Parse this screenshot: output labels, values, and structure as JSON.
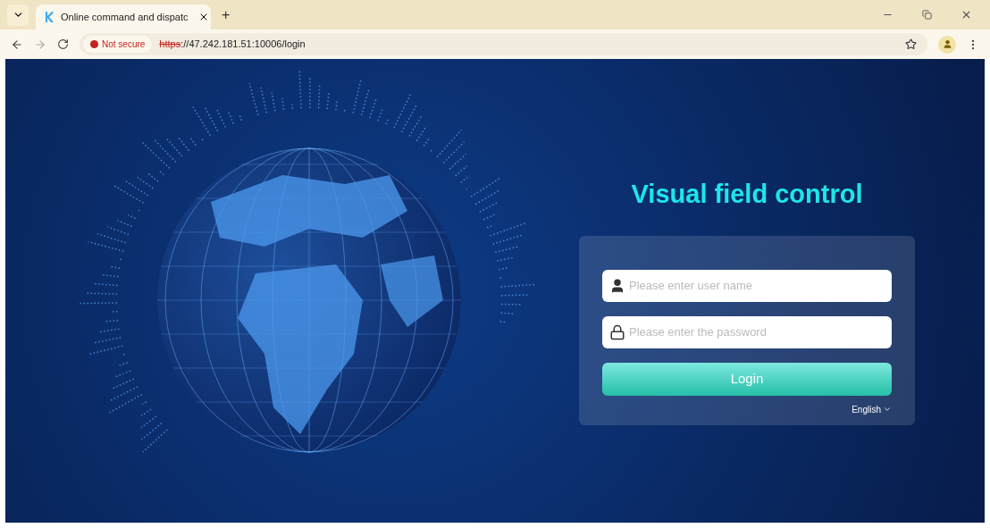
{
  "browser": {
    "tab_title": "Online command and dispatc",
    "new_tab": "+",
    "security": "Not secure",
    "url_scheme": "https",
    "url_rest": "://47.242.181.51:10006/login"
  },
  "login": {
    "title": "Visual field control",
    "fields": [
      {
        "kind": "user",
        "placeholder": "Please enter user name"
      },
      {
        "kind": "password",
        "placeholder": "Please enter the password"
      }
    ],
    "button": "Login",
    "language": "English"
  }
}
